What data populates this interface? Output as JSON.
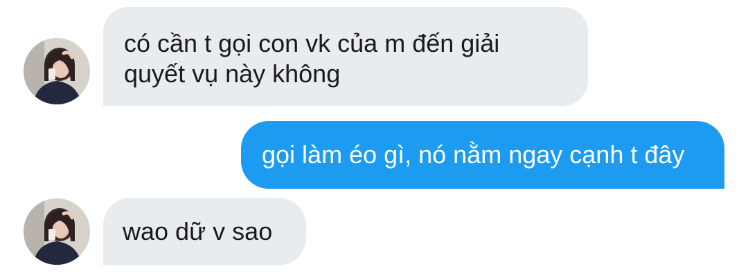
{
  "conversation": {
    "messages": [
      {
        "direction": "incoming",
        "text": "có cần t gọi con vk của m đến giải quyết vụ này không",
        "avatar_icon": "profile-photo-icon"
      },
      {
        "direction": "outgoing",
        "text": "gọi làm éo gì, nó nằm ngay cạnh t đây"
      },
      {
        "direction": "incoming",
        "text": "wao dữ v sao",
        "avatar_icon": "profile-photo-icon"
      }
    ]
  },
  "colors": {
    "incoming_bubble": "#e9ecef",
    "outgoing_bubble": "#1d9bf0",
    "incoming_text": "#1a1a1a",
    "outgoing_text": "#ffffff"
  }
}
